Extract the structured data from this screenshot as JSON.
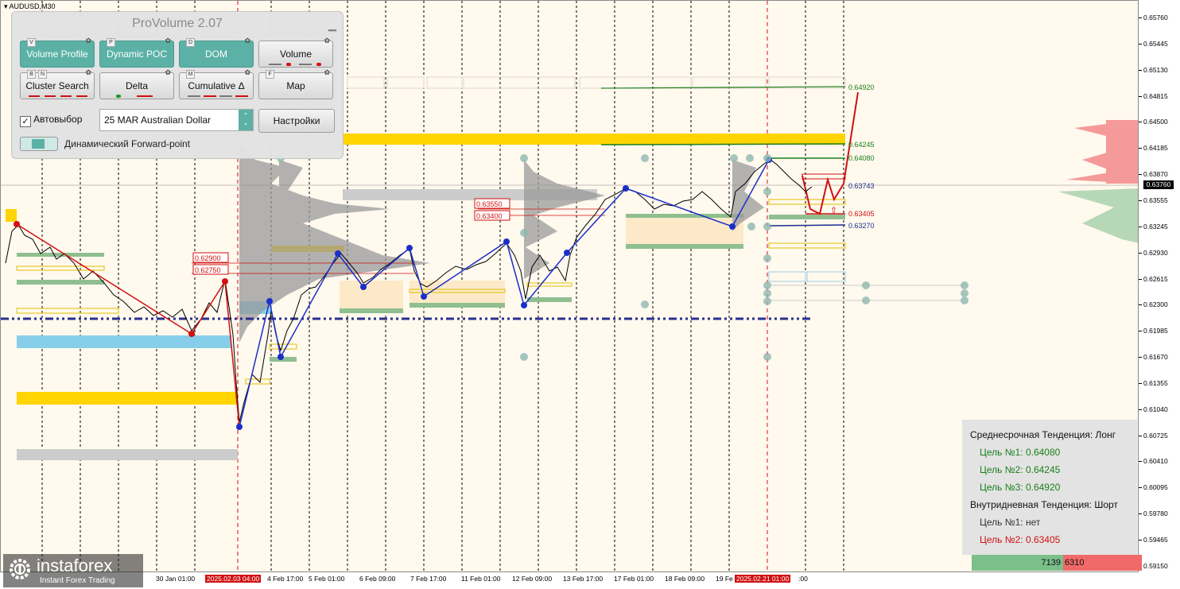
{
  "chart": {
    "symbol": "AUDUSD,M30",
    "current_price": "0.63760",
    "price_scale": [
      "0.65760",
      "0.65445",
      "0.65130",
      "0.64815",
      "0.64500",
      "0.64185",
      "0.63870",
      "0.63555",
      "0.63245",
      "0.62930",
      "0.62615",
      "0.62300",
      "0.61985",
      "0.61670",
      "0.61355",
      "0.61040",
      "0.60725",
      "0.60410",
      "0.60095",
      "0.59780",
      "0.59465",
      "0.59150"
    ],
    "time_scale": [
      "30 Jan 01:00",
      "2025.02.03 04:00",
      "4 Feb 17:00",
      "5 Feb 01:00",
      "6 Feb 09:00",
      "7 Feb 17:00",
      "11 Feb 01:00",
      "12 Feb 09:00",
      "13 Feb 17:00",
      "17 Feb 01:00",
      "18 Feb 09:00",
      "19 Fe",
      "2025.02.21 01:00",
      ":00"
    ],
    "highlighted_times": [
      "2025.02.03 04:00",
      "2025.02.21 01:00"
    ],
    "levels": {
      "target_3": "0.64920",
      "target_2": "0.64245",
      "target_1": "0.64080",
      "pivot": "0.63743",
      "intraday_target": "0.63405",
      "support": "0.63270",
      "box_upper": "0.63550",
      "box_lower": "0.63400",
      "left_upper": "0.62900",
      "left_lower": "0.62750"
    },
    "colors": {
      "bull": "#1a7f1a",
      "bear": "#d01010",
      "zigzag_up": "#1a2fc8",
      "zigzag_down": "#d01010",
      "gold_zone": "#ffd400",
      "blue_zone": "#87ceeb",
      "grey_zone": "#cccccc",
      "green_zone": "#8fbf8f",
      "trend_dashdot": "#2a2f8f",
      "panel_active": "#5bb1a6"
    }
  },
  "panel": {
    "title": "ProVolume 2.07",
    "minimize_icon": "minimize-icon",
    "buttons": [
      {
        "hotkey": "V",
        "label": "Volume Profile",
        "active": true
      },
      {
        "hotkey": "P",
        "label": "Dynamic POC",
        "active": true
      },
      {
        "hotkey": "D",
        "label": "DOM",
        "active": true
      },
      {
        "hotkey": "",
        "label": "Volume",
        "active": false
      },
      {
        "hotkey": "B",
        "hotkey2": "N",
        "label": "Cluster Search",
        "active": false
      },
      {
        "hotkey": "",
        "label": "Delta",
        "active": false
      },
      {
        "hotkey": "M",
        "label": "Cumulative Δ",
        "active": false
      },
      {
        "hotkey": "F",
        "label": "Map",
        "active": false
      }
    ],
    "autoselect_label": "Автовыбор",
    "autoselect_checked": true,
    "instrument": "25 MAR Australian Dollar",
    "settings_label": "Настройки",
    "forward_label": "Динамический Forward-point"
  },
  "info": {
    "medium_term": "Среднесрочная Тенденция: Лонг",
    "targets": [
      {
        "label": "Цель №1: 0.64080",
        "color": "#1a7f1a"
      },
      {
        "label": "Цель №2: 0.64245",
        "color": "#1a7f1a"
      },
      {
        "label": "Цель №3: 0.64920",
        "color": "#1a7f1a"
      }
    ],
    "intraday": "Внутридневная Тенденция: Шорт",
    "intraday_targets": [
      {
        "label": "Цель №1: нет",
        "color": "#333333"
      },
      {
        "label": "Цель №2: 0.63405",
        "color": "#d01010"
      }
    ],
    "volume_buy": "7139",
    "volume_sell": "6310"
  },
  "logo": {
    "name": "instaforex",
    "tagline": "Instant Forex Trading"
  }
}
